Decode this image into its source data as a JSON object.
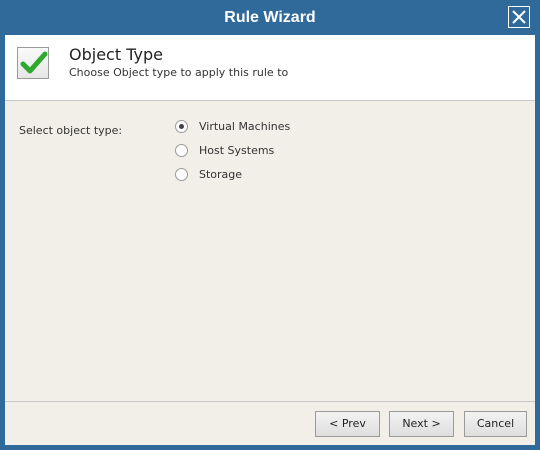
{
  "window": {
    "title": "Rule Wizard"
  },
  "header": {
    "title": "Object Type",
    "subtitle": "Choose Object type to apply this rule to",
    "icon": "checkmark-icon"
  },
  "form": {
    "label": "Select object type:",
    "options": [
      {
        "label": "Virtual Machines",
        "selected": true
      },
      {
        "label": "Host Systems",
        "selected": false
      },
      {
        "label": "Storage",
        "selected": false
      }
    ]
  },
  "footer": {
    "prev_label": "< Prev",
    "next_label": "Next >",
    "cancel_label": "Cancel"
  },
  "colors": {
    "titlebar": "#2f6a9a",
    "content_bg": "#f1efe7",
    "check_green": "#2ea82e"
  }
}
